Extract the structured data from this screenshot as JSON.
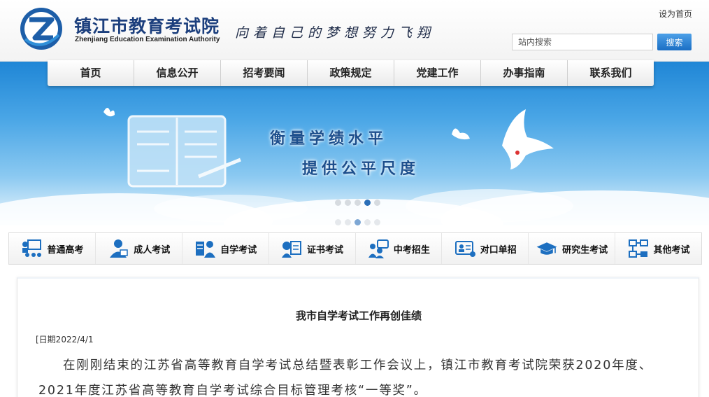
{
  "header": {
    "site_name": "镇江市教育考试院",
    "site_name_en": "Zhenjiang Education Examination Authority",
    "slogan": "向着自己的梦想努力飞翔",
    "set_home_label": "设为首页",
    "search_placeholder": "站内搜索",
    "search_button_label": "搜索"
  },
  "nav": {
    "items": [
      "首页",
      "信息公开",
      "招考要闻",
      "政策规定",
      "党建工作",
      "办事指南",
      "联系我们"
    ]
  },
  "banner": {
    "line1": "衡量学绩水平",
    "line2": "提供公平尺度",
    "slide_count": 5,
    "active_slide": 4
  },
  "categories": [
    {
      "label": "普通高考",
      "icon": "teacher-icon"
    },
    {
      "label": "成人考试",
      "icon": "adult-student-icon"
    },
    {
      "label": "自学考试",
      "icon": "self-study-icon"
    },
    {
      "label": "证书考试",
      "icon": "certificate-icon"
    },
    {
      "label": "中考招生",
      "icon": "chat-people-icon"
    },
    {
      "label": "对口单招",
      "icon": "id-card-icon"
    },
    {
      "label": "研究生考试",
      "icon": "graduation-cap-icon"
    },
    {
      "label": "其他考试",
      "icon": "network-icon"
    }
  ],
  "article": {
    "title": "我市自学考试工作再创佳绩",
    "date": "[日期2022/4/1",
    "body": "在刚刚结束的江苏省高等教育自学考试总结暨表彰工作会议上，镇江市教育考试院荣获2020年度、2021年度江苏省高等教育自学考试综合目标管理考核“一等奖”。"
  },
  "colors": {
    "brand_blue": "#1c3f7d",
    "search_button": "#1b6ec4",
    "icon_blue": "#1d6fc0"
  }
}
